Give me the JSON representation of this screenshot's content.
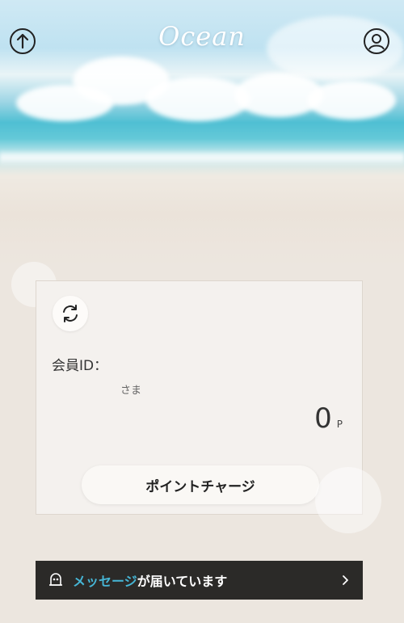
{
  "header": {
    "logo_text": "Ocean",
    "left_icon": "arrow-up-circle-icon",
    "right_icon": "user-circle-icon"
  },
  "card": {
    "refresh_icon": "refresh-icon",
    "member_id_label": "会員ID：",
    "honorific": "さま",
    "points_value": "0",
    "points_unit": "P",
    "charge_button_label": "ポイントチャージ"
  },
  "message_bar": {
    "icon": "mailbox-icon",
    "highlight_text": "メッセージ",
    "rest_text": "が届いています",
    "chevron_icon": "chevron-right-icon"
  },
  "colors": {
    "accent": "#46b6d6",
    "message_bar_bg": "#2b2a28",
    "page_bg": "#ece6df"
  }
}
